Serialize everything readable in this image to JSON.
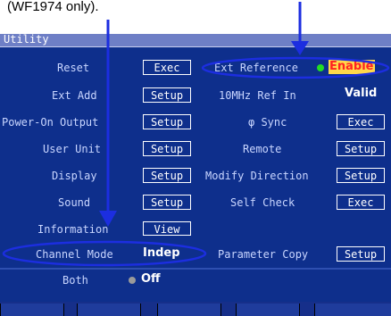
{
  "caption": "(WF1974 only).",
  "window_title": "Utility",
  "colors": {
    "screen_bg": "#0e2f8c",
    "label": "#c9d6ff",
    "accent": "#1c2ee0",
    "enable_bg": "#ffd84a",
    "enable_text": "#ff2222",
    "green_dot": "#22dd22"
  },
  "left_rows": [
    {
      "label": "Reset",
      "button": "Exec"
    },
    {
      "label": "Ext Add",
      "button": "Setup"
    },
    {
      "label": "Power-On Output",
      "button": "Setup"
    },
    {
      "label": "User Unit",
      "button": "Setup"
    },
    {
      "label": "Display",
      "button": "Setup"
    },
    {
      "label": "Sound",
      "button": "Setup"
    },
    {
      "label": "Information",
      "button": "View"
    }
  ],
  "channel_mode": {
    "label": "Channel Mode",
    "value": "Indep"
  },
  "both": {
    "label": "Both",
    "value": "Off"
  },
  "ext_reference": {
    "label": "Ext Reference",
    "value": "Enable"
  },
  "ref_in": {
    "label": "10MHz Ref In",
    "value": "Valid"
  },
  "right_rows": [
    {
      "label": "φ Sync",
      "button": "Exec"
    },
    {
      "label": "Remote",
      "button": "Setup"
    },
    {
      "label": "Modify Direction",
      "button": "Setup"
    },
    {
      "label": "Self Check",
      "button": "Exec"
    }
  ],
  "parameter_copy": {
    "label": "Parameter Copy",
    "button": "Setup"
  }
}
